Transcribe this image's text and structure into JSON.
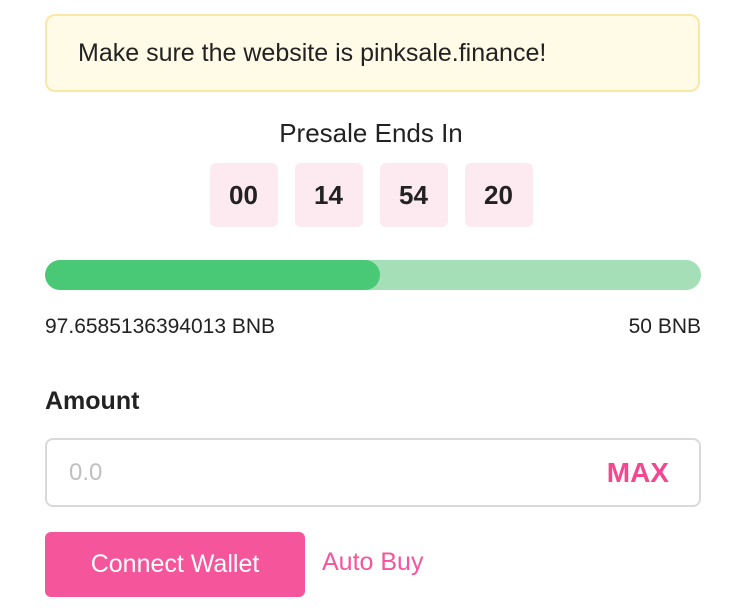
{
  "notice": {
    "text": "Make sure the website is pinksale.finance!"
  },
  "countdown": {
    "title": "Presale Ends In",
    "days": "00",
    "hours": "14",
    "minutes": "54",
    "seconds": "20"
  },
  "progress": {
    "fill_fraction": 0.51,
    "raised_label": "97.6585136394013 BNB",
    "cap_label": "50 BNB",
    "fill_color": "#49c875",
    "track_color": "#a5dfb8"
  },
  "amount": {
    "label": "Amount",
    "placeholder": "0.0",
    "value": "",
    "max_label": "MAX"
  },
  "actions": {
    "connect_label": "Connect Wallet",
    "auto_buy_label": "Auto Buy"
  },
  "colors": {
    "accent": "#f5559a",
    "notice_bg": "#fffbe6",
    "notice_border": "#fbe7a4",
    "timer_bg": "#fdeaf0"
  }
}
